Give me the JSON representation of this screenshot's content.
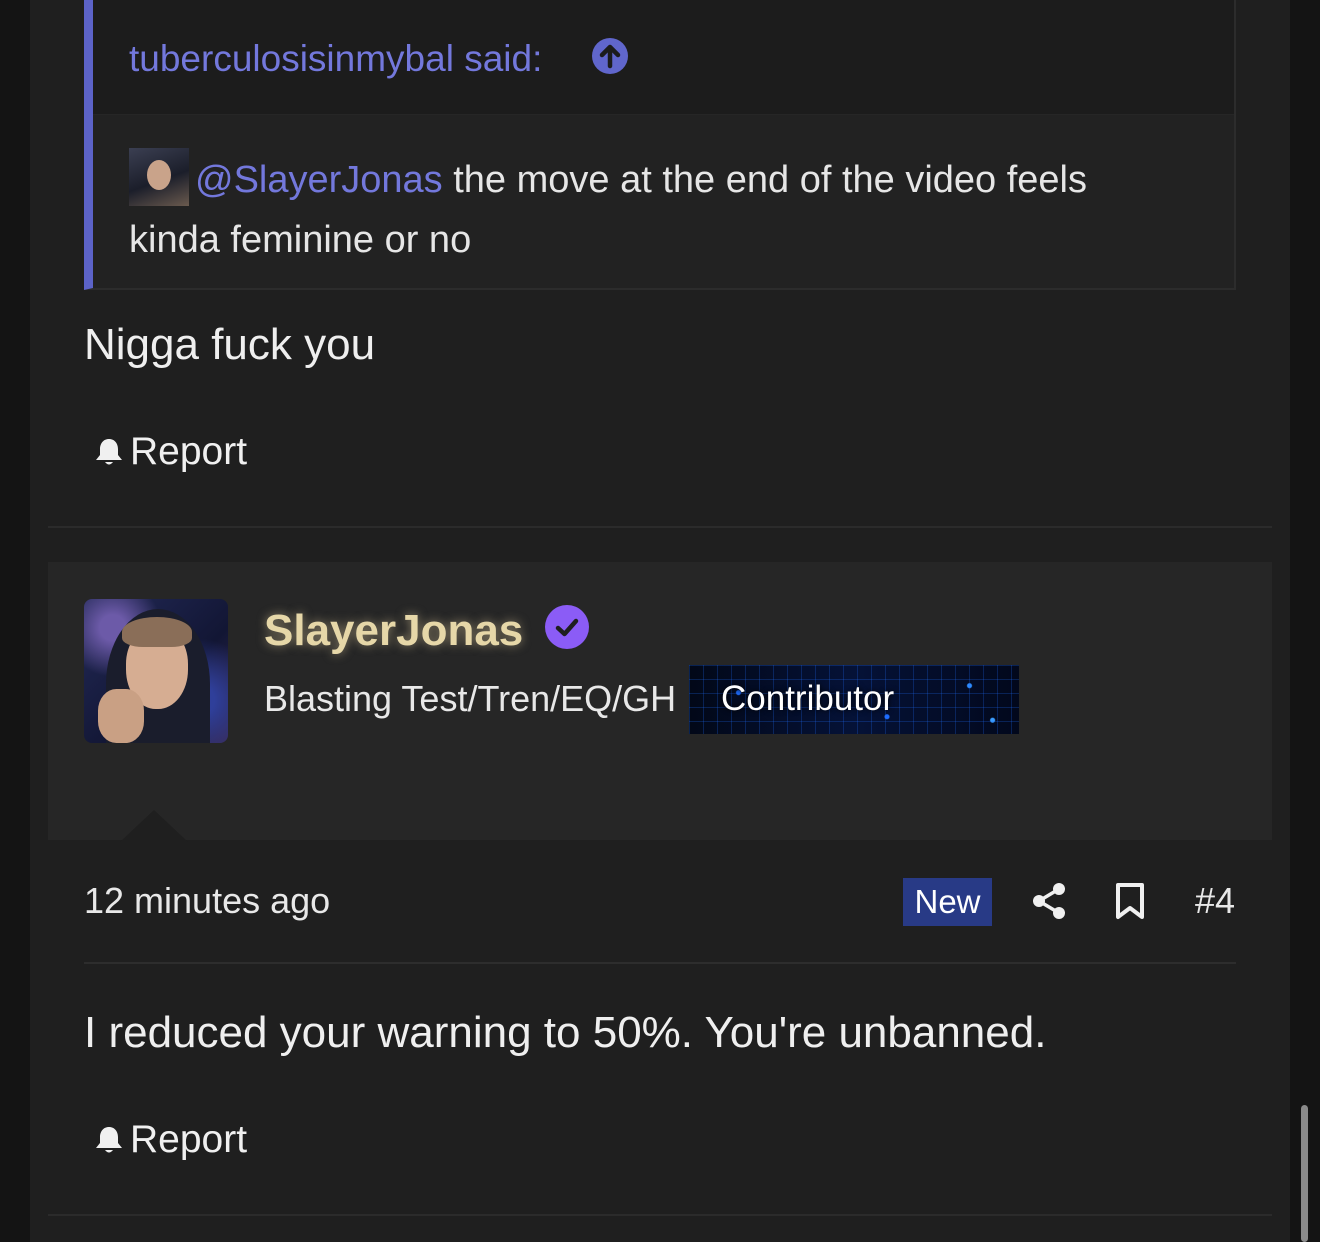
{
  "quote": {
    "author_label": "tuberculosisinmybal said:",
    "mention": "@SlayerJonas",
    "text": " the move at the end of the video feels kinda feminine or no"
  },
  "post1": {
    "text": "Nigga fuck you",
    "report_label": "Report"
  },
  "user": {
    "username": "SlayerJonas",
    "title": "Blasting Test/Tren/EQ/GH",
    "banner": "Contributor",
    "accent_color": "#e6d7a8",
    "verified_color": "#8b5cf6"
  },
  "post2": {
    "time": "12 minutes ago",
    "badge": "New",
    "number": "#4",
    "text": "I reduced your warning to 50%. You're unbanned.",
    "report_label": "Report"
  },
  "colors": {
    "link": "#7378dc",
    "quote_border": "#5c63c8",
    "new_badge": "#283a86"
  }
}
